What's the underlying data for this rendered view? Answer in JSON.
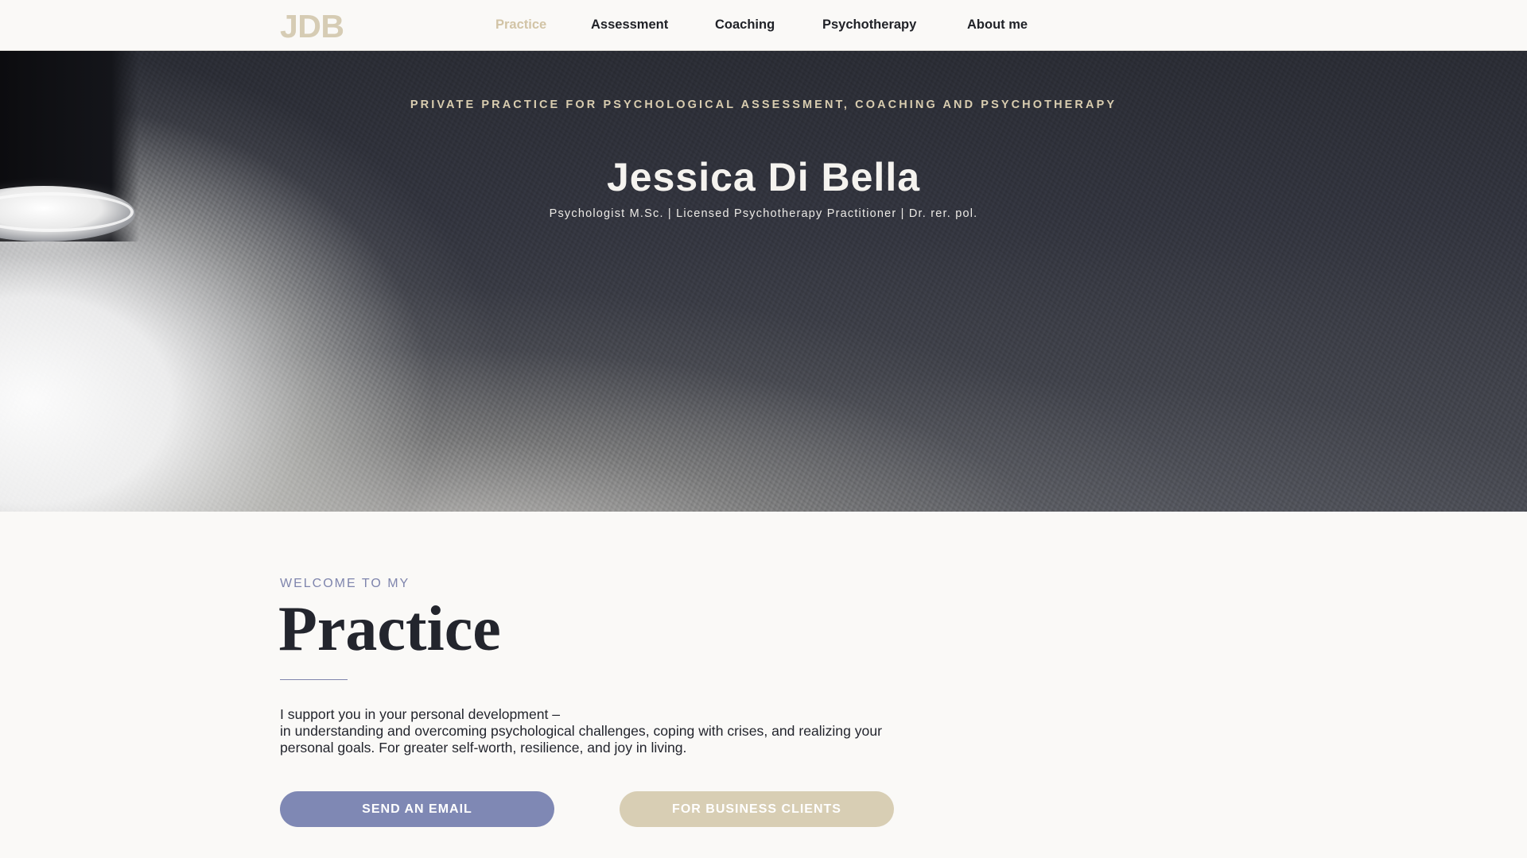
{
  "brand": {
    "logo": "JDB",
    "accent_color": "#d6ccb4",
    "secondary_color": "#7f88b4"
  },
  "nav": {
    "items": [
      {
        "label": "Practice",
        "active": true
      },
      {
        "label": "Assessment",
        "active": false
      },
      {
        "label": "Coaching",
        "active": false
      },
      {
        "label": "Psychotherapy",
        "active": false
      },
      {
        "label": "About me",
        "active": false
      }
    ]
  },
  "hero": {
    "tagline": "PRIVATE PRACTICE FOR PSYCHOLOGICAL ASSESSMENT, COACHING AND PSYCHOTHERAPY",
    "name": "Jessica Di Bella",
    "credentials": "Psychologist M.Sc. | Licensed Psychotherapy Practitioner | Dr. rer. pol."
  },
  "welcome": {
    "eyebrow": "WELCOME TO MY",
    "title": "Practice",
    "intro_line_1": "I support you in your personal development –",
    "intro_line_2": "in understanding and overcoming psychological challenges, coping with crises, and realizing your personal goals. For greater self-worth, resilience, and joy in living."
  },
  "buttons": {
    "email_label": "SEND AN EMAIL",
    "business_label": "FOR BUSINESS CLIENTS"
  }
}
